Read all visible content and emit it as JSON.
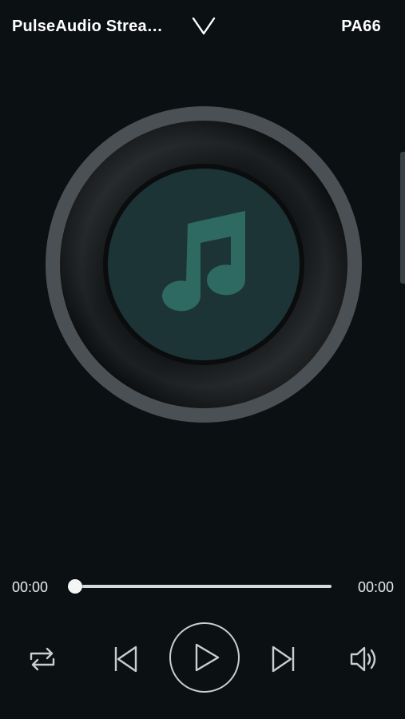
{
  "header": {
    "title": "PulseAudio Strea…",
    "device": "PA66",
    "collapse_icon": "chevron-down-icon"
  },
  "artwork": {
    "icon": "music-note-icon",
    "colors": {
      "disc_outer_ring": "#4a5053",
      "disc_vinyl": "#111416",
      "label": "#1c3436",
      "note": "#2f6a62"
    }
  },
  "playback": {
    "elapsed": "00:00",
    "total": "00:00",
    "progress": 0.0
  },
  "controls": {
    "repeat_icon": "repeat-icon",
    "previous_icon": "skip-previous-icon",
    "play_icon": "play-icon",
    "next_icon": "skip-next-icon",
    "volume_icon": "volume-icon"
  },
  "colors": {
    "background": "#0b1012",
    "text": "#ffffff",
    "icons": "#c9cfd1"
  }
}
